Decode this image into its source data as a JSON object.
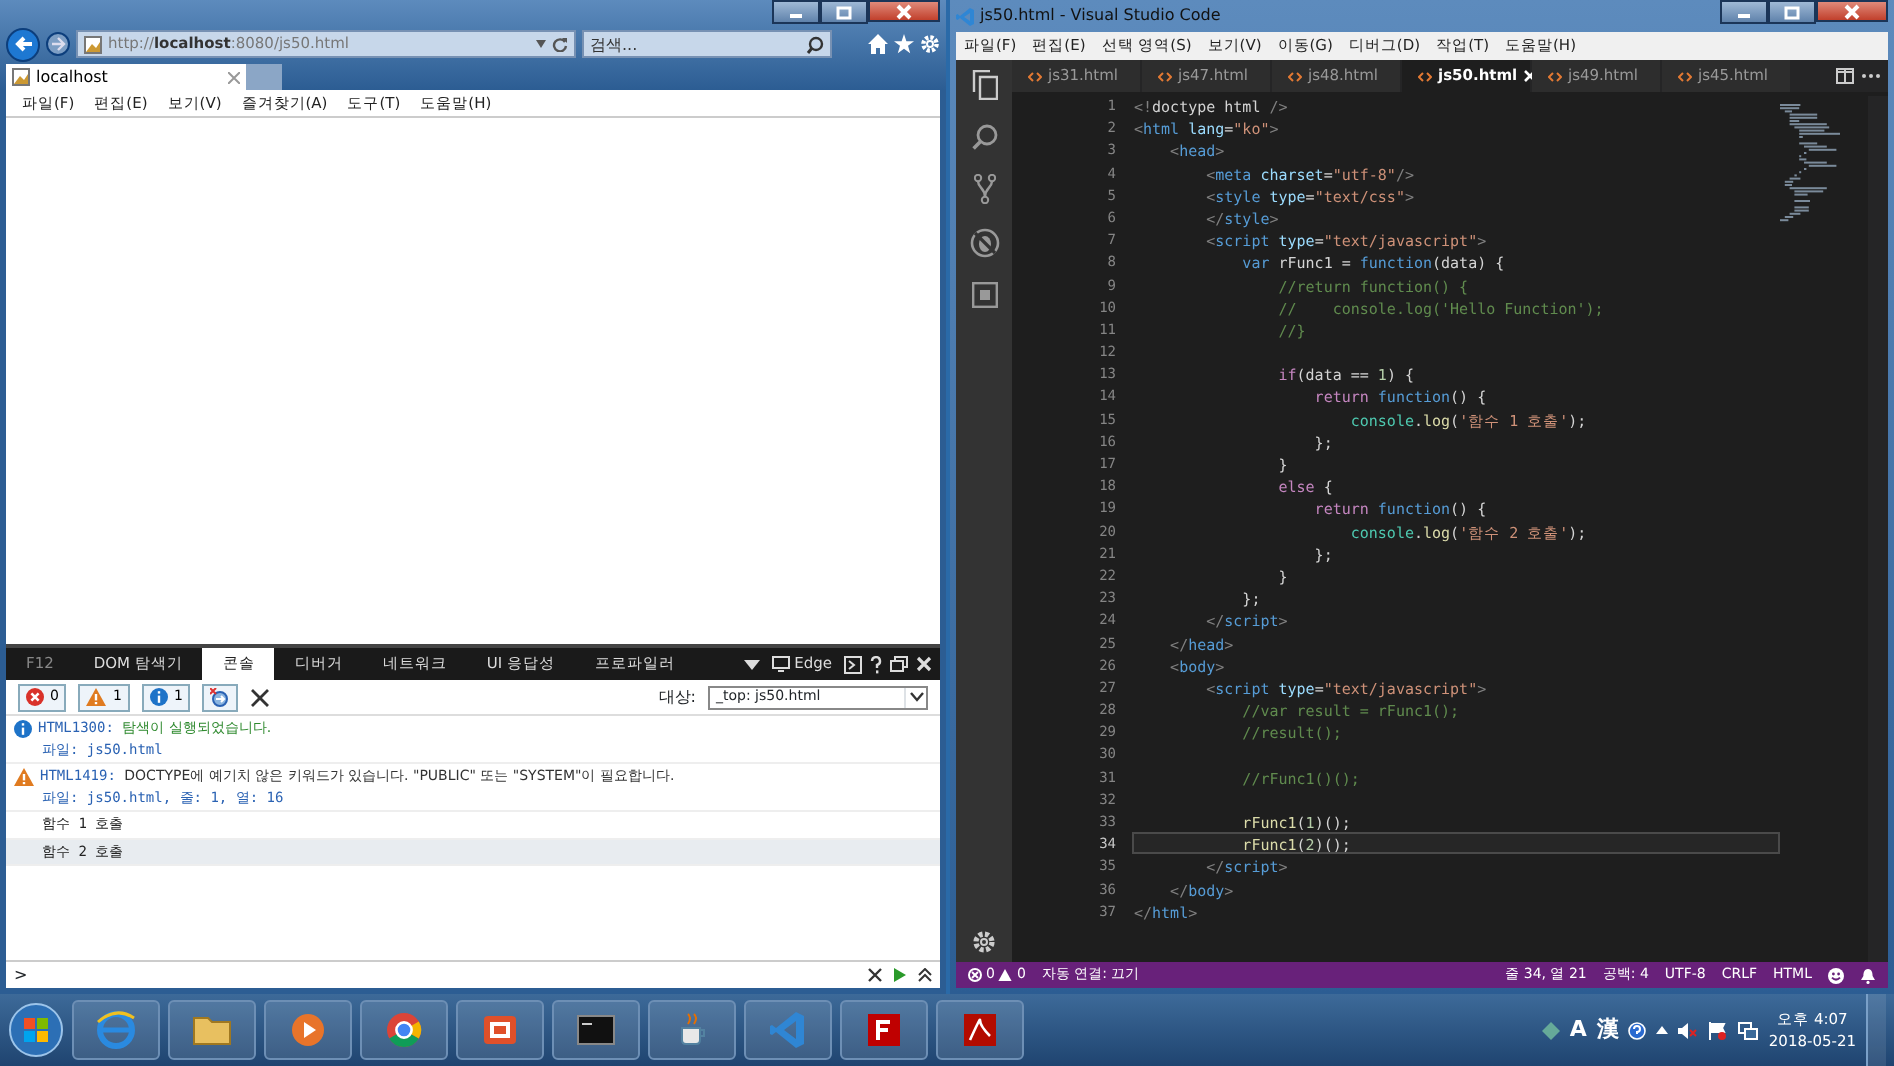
{
  "browser": {
    "address": "http://**localhost**:8080/js50.html",
    "search": {
      "placeholder": "검색..."
    },
    "tabs": [
      {
        "title": "localhost",
        "selected": true
      }
    ],
    "menu": [
      "파일(F)",
      "편집(E)",
      "보기(V)",
      "즐겨찾기(A)",
      "도구(T)",
      "도움말(H)"
    ],
    "devtools": {
      "tabs": [
        {
          "label": "F12",
          "selected": false
        },
        {
          "label": "DOM 탐색기",
          "selected": false
        },
        {
          "label": "콘솔",
          "selected": true
        },
        {
          "label": "디버거",
          "selected": false
        },
        {
          "label": "네트워크",
          "selected": false
        },
        {
          "label": "UI 응답성",
          "selected": false
        },
        {
          "label": "프로파일러",
          "selected": false
        }
      ],
      "emulation": "Edge",
      "counters": [
        {
          "kind": "error",
          "count": "0"
        },
        {
          "kind": "warning",
          "count": "1"
        },
        {
          "kind": "info",
          "count": "1"
        }
      ],
      "target_label": "대상:",
      "target": "_top: js50.html",
      "messages": [
        {
          "kind": "info",
          "code": "HTML1300:",
          "text": "탐색이 실행되었습니다.",
          "detail": "파일: js50.html",
          "selected": false
        },
        {
          "kind": "warning",
          "code": "HTML1419:",
          "text": "DOCTYPE에 예기치 않은 키워드가 있습니다. \"PUBLIC\" 또는 \"SYSTEM\"이 필요합니다.",
          "detail": "파일: js50.html, 줄: 1, 열: 16",
          "selected": false
        },
        {
          "kind": "log",
          "text": "함수 1 호출",
          "selected": false
        },
        {
          "kind": "log",
          "text": "함수 2 호출",
          "selected": true
        }
      ],
      "prompt": ">"
    }
  },
  "editor": {
    "title": "js50.html - Visual Studio Code",
    "menu": [
      "파일(F)",
      "편집(E)",
      "선택 영역(S)",
      "보기(V)",
      "이동(G)",
      "디버그(D)",
      "작업(T)",
      "도움말(H)"
    ],
    "tabs": [
      {
        "label": "js31.html",
        "selected": false
      },
      {
        "label": "js47.html",
        "selected": false
      },
      {
        "label": "js48.html",
        "selected": false
      },
      {
        "label": "js50.html",
        "selected": true
      },
      {
        "label": "js49.html",
        "selected": false
      },
      {
        "label": "js45.html",
        "selected": false
      }
    ],
    "lines": [
      {
        "number": "1",
        "current": false,
        "segments": [
          {
            "kind": "punct",
            "text": "<!"
          },
          {
            "kind": "plain",
            "text": "doctype html"
          },
          {
            "kind": "punct",
            "text": " />"
          }
        ]
      },
      {
        "number": "2",
        "current": false,
        "segments": [
          {
            "kind": "punct",
            "text": "<"
          },
          {
            "kind": "tag",
            "text": "html"
          },
          {
            "kind": "attr",
            "text": " lang"
          },
          {
            "kind": "plain",
            "text": "="
          },
          {
            "kind": "string",
            "text": "\"ko\""
          },
          {
            "kind": "punct",
            "text": ">"
          }
        ]
      },
      {
        "number": "3",
        "current": false,
        "segments": [
          {
            "kind": "punct",
            "text": "    <"
          },
          {
            "kind": "tag",
            "text": "head"
          },
          {
            "kind": "punct",
            "text": ">"
          }
        ]
      },
      {
        "number": "4",
        "current": false,
        "segments": [
          {
            "kind": "punct",
            "text": "        <"
          },
          {
            "kind": "tag",
            "text": "meta"
          },
          {
            "kind": "attr",
            "text": " charset"
          },
          {
            "kind": "plain",
            "text": "="
          },
          {
            "kind": "string",
            "text": "\"utf-8\""
          },
          {
            "kind": "punct",
            "text": "/>"
          }
        ]
      },
      {
        "number": "5",
        "current": false,
        "segments": [
          {
            "kind": "punct",
            "text": "        <"
          },
          {
            "kind": "tag",
            "text": "style"
          },
          {
            "kind": "attr",
            "text": " type"
          },
          {
            "kind": "plain",
            "text": "="
          },
          {
            "kind": "string",
            "text": "\"text/css\""
          },
          {
            "kind": "punct",
            "text": ">"
          }
        ]
      },
      {
        "number": "6",
        "current": false,
        "segments": [
          {
            "kind": "punct",
            "text": "        </"
          },
          {
            "kind": "tag",
            "text": "style"
          },
          {
            "kind": "punct",
            "text": ">"
          }
        ]
      },
      {
        "number": "7",
        "current": false,
        "segments": [
          {
            "kind": "punct",
            "text": "        <"
          },
          {
            "kind": "tag",
            "text": "script"
          },
          {
            "kind": "attr",
            "text": " type"
          },
          {
            "kind": "plain",
            "text": "="
          },
          {
            "kind": "string",
            "text": "\"text/javascript\""
          },
          {
            "kind": "punct",
            "text": ">"
          }
        ]
      },
      {
        "number": "8",
        "current": false,
        "segments": [
          {
            "kind": "keyword",
            "text": "            var"
          },
          {
            "kind": "variable",
            "text": " rFunc1"
          },
          {
            "kind": "plain",
            "text": " = "
          },
          {
            "kind": "keyword",
            "text": "function"
          },
          {
            "kind": "plain",
            "text": "("
          },
          {
            "kind": "variable",
            "text": "data"
          },
          {
            "kind": "plain",
            "text": ") {"
          }
        ]
      },
      {
        "number": "9",
        "current": false,
        "segments": [
          {
            "kind": "comment",
            "text": "                //return function() {"
          }
        ]
      },
      {
        "number": "10",
        "current": false,
        "segments": [
          {
            "kind": "comment",
            "text": "                //    console.log('Hello Function');"
          }
        ]
      },
      {
        "number": "11",
        "current": false,
        "segments": [
          {
            "kind": "comment",
            "text": "                //}"
          }
        ]
      },
      {
        "number": "12",
        "current": false
      },
      {
        "number": "13",
        "current": false,
        "segments": [
          {
            "kind": "control",
            "text": "                if"
          },
          {
            "kind": "plain",
            "text": "("
          },
          {
            "kind": "variable",
            "text": "data"
          },
          {
            "kind": "plain",
            "text": " == "
          },
          {
            "kind": "number",
            "text": "1"
          },
          {
            "kind": "plain",
            "text": ") {"
          }
        ]
      },
      {
        "number": "14",
        "current": false,
        "segments": [
          {
            "kind": "control",
            "text": "                    return"
          },
          {
            "kind": "keyword",
            "text": " function"
          },
          {
            "kind": "plain",
            "text": "() {"
          }
        ]
      },
      {
        "number": "15",
        "current": false,
        "segments": [
          {
            "kind": "class",
            "text": "                        console"
          },
          {
            "kind": "plain",
            "text": "."
          },
          {
            "kind": "function",
            "text": "log"
          },
          {
            "kind": "plain",
            "text": "("
          },
          {
            "kind": "string",
            "text": "'함수 1 호출'"
          },
          {
            "kind": "plain",
            "text": ");"
          }
        ]
      },
      {
        "number": "16",
        "current": false,
        "segments": [
          {
            "kind": "plain",
            "text": "                    };"
          }
        ]
      },
      {
        "number": "17",
        "current": false,
        "segments": [
          {
            "kind": "plain",
            "text": "                }"
          }
        ]
      },
      {
        "number": "18",
        "current": false,
        "segments": [
          {
            "kind": "control",
            "text": "                else"
          },
          {
            "kind": "plain",
            "text": " {"
          }
        ]
      },
      {
        "number": "19",
        "current": false,
        "segments": [
          {
            "kind": "control",
            "text": "                    return"
          },
          {
            "kind": "keyword",
            "text": " function"
          },
          {
            "kind": "plain",
            "text": "() {"
          }
        ]
      },
      {
        "number": "20",
        "current": false,
        "segments": [
          {
            "kind": "class",
            "text": "                        console"
          },
          {
            "kind": "plain",
            "text": "."
          },
          {
            "kind": "function",
            "text": "log"
          },
          {
            "kind": "plain",
            "text": "("
          },
          {
            "kind": "string",
            "text": "'함수 2 호출'"
          },
          {
            "kind": "plain",
            "text": ");"
          }
        ]
      },
      {
        "number": "21",
        "current": false,
        "segments": [
          {
            "kind": "plain",
            "text": "                    };"
          }
        ]
      },
      {
        "number": "22",
        "current": false,
        "segments": [
          {
            "kind": "plain",
            "text": "                }"
          }
        ]
      },
      {
        "number": "23",
        "current": false,
        "segments": [
          {
            "kind": "plain",
            "text": "            };"
          }
        ]
      },
      {
        "number": "24",
        "current": false,
        "segments": [
          {
            "kind": "punct",
            "text": "        </"
          },
          {
            "kind": "tag",
            "text": "script"
          },
          {
            "kind": "punct",
            "text": ">"
          }
        ]
      },
      {
        "number": "25",
        "current": false,
        "segments": [
          {
            "kind": "punct",
            "text": "    </"
          },
          {
            "kind": "tag",
            "text": "head"
          },
          {
            "kind": "punct",
            "text": ">"
          }
        ]
      },
      {
        "number": "26",
        "current": false,
        "segments": [
          {
            "kind": "punct",
            "text": "    <"
          },
          {
            "kind": "tag",
            "text": "body"
          },
          {
            "kind": "punct",
            "text": ">"
          }
        ]
      },
      {
        "number": "27",
        "current": false,
        "segments": [
          {
            "kind": "punct",
            "text": "        <"
          },
          {
            "kind": "tag",
            "text": "script"
          },
          {
            "kind": "attr",
            "text": " type"
          },
          {
            "kind": "plain",
            "text": "="
          },
          {
            "kind": "string",
            "text": "\"text/javascript\""
          },
          {
            "kind": "punct",
            "text": ">"
          }
        ]
      },
      {
        "number": "28",
        "current": false,
        "segments": [
          {
            "kind": "comment",
            "text": "            //var result = rFunc1();"
          }
        ]
      },
      {
        "number": "29",
        "current": false,
        "segments": [
          {
            "kind": "comment",
            "text": "            //result();"
          }
        ]
      },
      {
        "number": "30",
        "current": false
      },
      {
        "number": "31",
        "current": false,
        "segments": [
          {
            "kind": "comment",
            "text": "            //rFunc1()();"
          }
        ]
      },
      {
        "number": "32",
        "current": false
      },
      {
        "number": "33",
        "current": false,
        "segments": [
          {
            "kind": "function",
            "text": "            rFunc1"
          },
          {
            "kind": "plain",
            "text": "("
          },
          {
            "kind": "number",
            "text": "1"
          },
          {
            "kind": "plain",
            "text": ")();"
          }
        ]
      },
      {
        "number": "34",
        "current": true,
        "segments": [
          {
            "kind": "function",
            "text": "            rFunc1"
          },
          {
            "kind": "plain",
            "text": "("
          },
          {
            "kind": "number",
            "text": "2"
          },
          {
            "kind": "plain",
            "text": ")();"
          }
        ]
      },
      {
        "number": "35",
        "current": false,
        "segments": [
          {
            "kind": "punct",
            "text": "        </"
          },
          {
            "kind": "tag",
            "text": "script"
          },
          {
            "kind": "punct",
            "text": ">"
          }
        ]
      },
      {
        "number": "36",
        "current": false,
        "segments": [
          {
            "kind": "punct",
            "text": "    </"
          },
          {
            "kind": "tag",
            "text": "body"
          },
          {
            "kind": "punct",
            "text": ">"
          }
        ]
      },
      {
        "number": "37",
        "current": false,
        "segments": [
          {
            "kind": "punct",
            "text": "</"
          },
          {
            "kind": "tag",
            "text": "html"
          },
          {
            "kind": "punct",
            "text": ">"
          }
        ]
      }
    ],
    "status_bar": {
      "errors": "0",
      "warnings": "0",
      "live_share": "자동 연결: 끄기",
      "items": [
        "줄 34, 열 21",
        "공백: 4",
        "UTF-8",
        "CRLF",
        "HTML"
      ]
    }
  },
  "taskbar": {
    "ime": [
      "A",
      "漢"
    ],
    "time": "오후 4:07",
    "date": "2018-05-21"
  }
}
